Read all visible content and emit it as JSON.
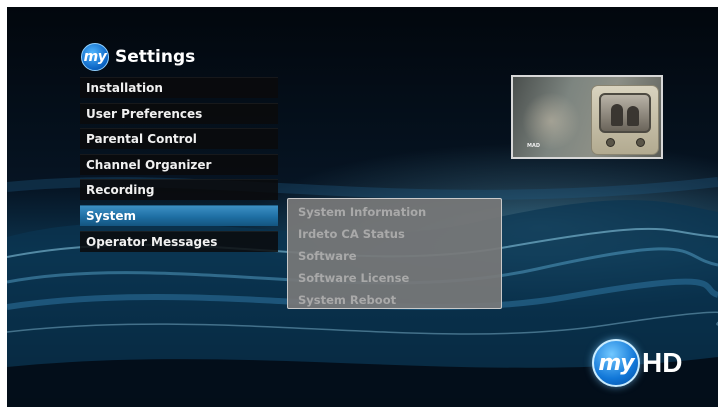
{
  "header": {
    "logo_text": "my",
    "title": "Settings"
  },
  "menu": {
    "items": [
      {
        "label": "Installation"
      },
      {
        "label": "User Preferences"
      },
      {
        "label": "Parental Control"
      },
      {
        "label": "Channel Organizer"
      },
      {
        "label": "Recording"
      },
      {
        "label": "System"
      },
      {
        "label": "Operator Messages"
      }
    ],
    "selected": "System"
  },
  "submenu": {
    "items": [
      {
        "label": "System Information"
      },
      {
        "label": "Irdeto CA Status"
      },
      {
        "label": "Software"
      },
      {
        "label": "Software License"
      },
      {
        "label": "System Reboot"
      }
    ]
  },
  "preview": {
    "channel_label": "MAD"
  },
  "brand": {
    "logo_circle_text": "my",
    "logo_text": "HD"
  },
  "colors": {
    "selected_item": "#1e6ea3",
    "menu_item_bg": "#0a0a0c",
    "submenu_bg": "#787878",
    "submenu_text_disabled": "#a9a9a9"
  }
}
